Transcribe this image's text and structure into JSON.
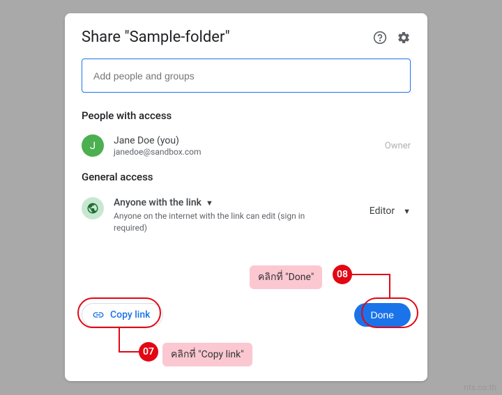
{
  "dialog": {
    "title": "Share \"Sample-folder\"",
    "input_placeholder": "Add people and groups"
  },
  "people_section": {
    "heading": "People with access",
    "person": {
      "avatar_letter": "J",
      "name": "Jane Doe (you)",
      "email": "janedoe@sandbox.com",
      "role": "Owner"
    }
  },
  "general_section": {
    "heading": "General access",
    "access_label": "Anyone with the link",
    "access_description": "Anyone on the internet with the link can edit (sign in required)",
    "role": "Editor"
  },
  "footer": {
    "copy_link": "Copy link",
    "done": "Done"
  },
  "annotations": {
    "badge07": "07",
    "badge08": "08",
    "callout07": "คลิกที่ \"Copy link\"",
    "callout08": "คลิกที่ \"Done\""
  },
  "watermark": "nts.co.th"
}
